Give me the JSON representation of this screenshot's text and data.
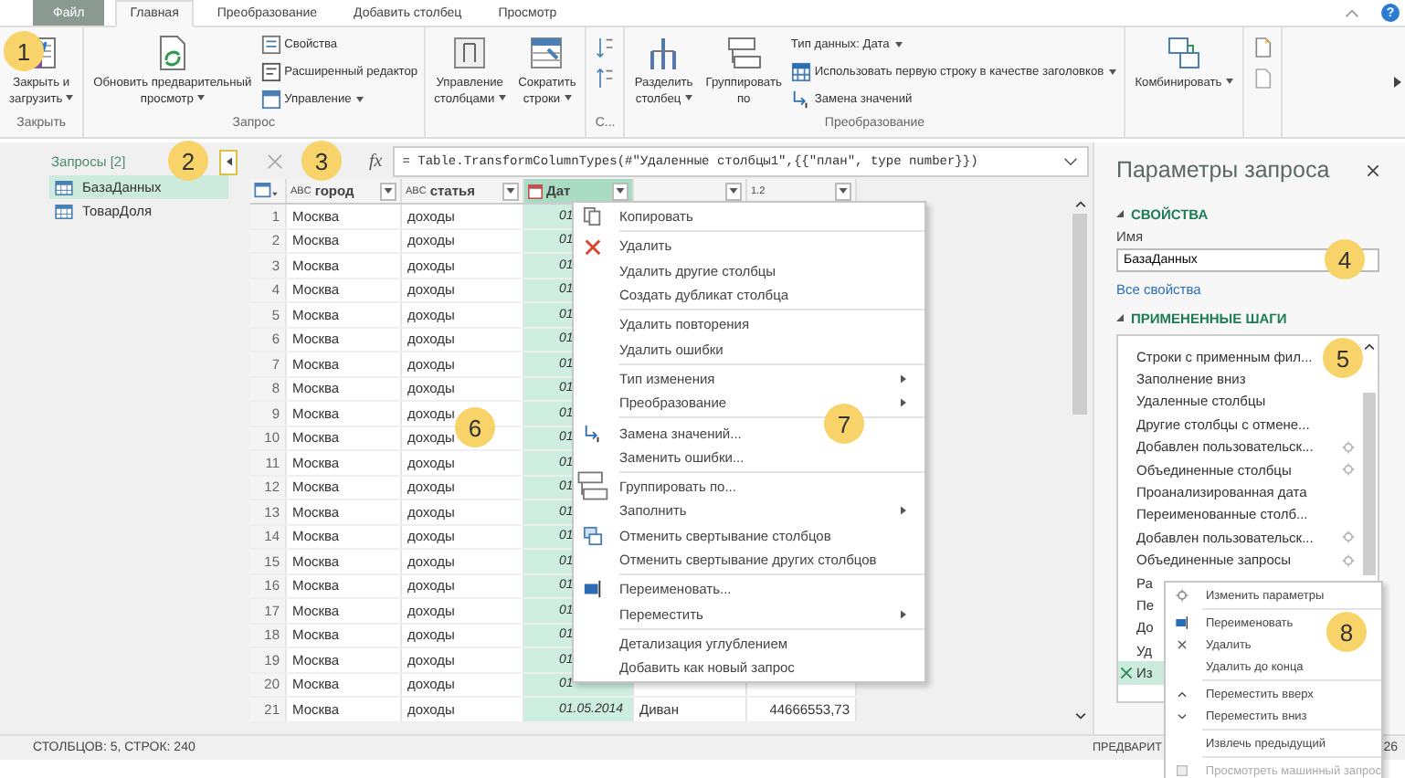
{
  "tabs": [
    {
      "label": "Файл",
      "kind": "file",
      "selected": false
    },
    {
      "label": "Главная",
      "kind": "tab",
      "selected": true
    },
    {
      "label": "Преобразование",
      "kind": "tab",
      "selected": false
    },
    {
      "label": "Добавить столбец",
      "kind": "tab",
      "selected": false
    },
    {
      "label": "Просмотр",
      "kind": "tab",
      "selected": false
    }
  ],
  "help_button": "?",
  "ribbon": {
    "groups": [
      {
        "label": "Закрыть",
        "buttons": [
          {
            "label": "Закрыть и\nзагрузить",
            "kind": "large",
            "dropdown": true
          }
        ]
      },
      {
        "label": "Запрос",
        "buttons": [
          {
            "label": "Обновить предварительный\nпросмотр",
            "kind": "large",
            "dropdown": true
          },
          {
            "label": "Свойства",
            "kind": "small",
            "dropdown": false
          },
          {
            "label": "Расширенный редактор",
            "kind": "small",
            "dropdown": false
          },
          {
            "label": "Управление",
            "kind": "small",
            "dropdown": true
          }
        ]
      },
      {
        "buttons": [
          {
            "label": "Управление\nстолбцами",
            "kind": "large",
            "dropdown": true
          },
          {
            "label": "Сократить\nстроки",
            "kind": "large",
            "dropdown": true
          }
        ]
      },
      {
        "label": "С...",
        "buttons": [
          {
            "kind": "sort"
          }
        ]
      },
      {
        "label": "Преобразование",
        "buttons": [
          {
            "label": "Разделить\nстолбец",
            "kind": "large",
            "dropdown": true
          },
          {
            "label": "Группировать\nпо",
            "kind": "large",
            "dropdown": false
          },
          {
            "label": "Тип данных: Дата",
            "kind": "small",
            "dropdown": true
          },
          {
            "label": "Использовать первую строку в качестве заголовков",
            "kind": "small",
            "dropdown": true
          },
          {
            "label": "Замена значений",
            "kind": "small",
            "dropdown": false
          }
        ]
      },
      {
        "buttons": [
          {
            "label": "Комбинировать",
            "kind": "large",
            "dropdown": true
          }
        ]
      },
      {
        "buttons": [
          {
            "kind": "icons"
          }
        ]
      }
    ]
  },
  "queries": {
    "title": "Запросы [2]",
    "items": [
      {
        "label": "БазаДанных",
        "selected": true
      },
      {
        "label": "ТоварДоля",
        "selected": false
      }
    ]
  },
  "formula_bar": {
    "fx": "fx",
    "formula": "= Table.TransformColumnTypes(#\"Удаленные столбцы1\",{{\"план\", type number}})"
  },
  "table": {
    "columns": [
      {
        "kind": "index",
        "selected": false
      },
      {
        "label": "город",
        "type": "ABC",
        "kind": "text",
        "selected": false
      },
      {
        "label": "статья",
        "type": "ABC",
        "kind": "text",
        "selected": false
      },
      {
        "label": "Дат",
        "kind": "date",
        "selected": true
      },
      {
        "kind": "text",
        "selected": false
      },
      {
        "type": "1.2",
        "kind": "number",
        "selected": false
      }
    ],
    "rows": [
      [
        "1",
        "Москва",
        "доходы",
        "01"
      ],
      [
        "2",
        "Москва",
        "доходы",
        "01"
      ],
      [
        "3",
        "Москва",
        "доходы",
        "01"
      ],
      [
        "4",
        "Москва",
        "доходы",
        "01"
      ],
      [
        "5",
        "Москва",
        "доходы",
        "01"
      ],
      [
        "6",
        "Москва",
        "доходы",
        "01"
      ],
      [
        "7",
        "Москва",
        "доходы",
        "01"
      ],
      [
        "8",
        "Москва",
        "доходы",
        "01"
      ],
      [
        "9",
        "Москва",
        "доходы",
        "01"
      ],
      [
        "10",
        "Москва",
        "доходы",
        "01"
      ],
      [
        "11",
        "Москва",
        "доходы",
        "01"
      ],
      [
        "12",
        "Москва",
        "доходы",
        "01"
      ],
      [
        "13",
        "Москва",
        "доходы",
        "01"
      ],
      [
        "14",
        "Москва",
        "доходы",
        "01"
      ],
      [
        "15",
        "Москва",
        "доходы",
        "01"
      ],
      [
        "16",
        "Москва",
        "доходы",
        "01"
      ],
      [
        "17",
        "Москва",
        "доходы",
        "01"
      ],
      [
        "18",
        "Москва",
        "доходы",
        "01"
      ],
      [
        "19",
        "Москва",
        "доходы",
        "01"
      ],
      [
        "20",
        "Москва",
        "доходы",
        "01"
      ],
      [
        "21",
        "Москва",
        "доходы",
        "01.05.2014",
        "Диван",
        "44666553,73"
      ]
    ]
  },
  "column_menu": [
    [
      {
        "label": "Копировать",
        "has_submenu": false
      }
    ],
    [
      {
        "label": "Удалить",
        "has_submenu": false
      },
      {
        "label": "Удалить другие столбцы",
        "has_submenu": false
      },
      {
        "label": "Создать дубликат столбца",
        "has_submenu": false
      }
    ],
    [
      {
        "label": "Удалить повторения",
        "has_submenu": false
      },
      {
        "label": "Удалить ошибки",
        "has_submenu": false
      }
    ],
    [
      {
        "label": "Тип изменения",
        "has_submenu": true
      },
      {
        "label": "Преобразование",
        "has_submenu": true
      }
    ],
    [
      {
        "label": "Замена значений...",
        "has_submenu": false
      },
      {
        "label": "Заменить ошибки...",
        "has_submenu": false
      }
    ],
    [
      {
        "label": "Группировать по...",
        "has_submenu": false
      },
      {
        "label": "Заполнить",
        "has_submenu": true
      },
      {
        "label": "Отменить свертывание столбцов",
        "has_submenu": false
      },
      {
        "label": "Отменить свертывание других столбцов",
        "has_submenu": false
      }
    ],
    [
      {
        "label": "Переименовать...",
        "has_submenu": false
      },
      {
        "label": "Переместить",
        "has_submenu": true
      }
    ],
    [
      {
        "label": "Детализация углублением",
        "has_submenu": false
      },
      {
        "label": "Добавить как новый запрос",
        "has_submenu": false
      }
    ]
  ],
  "query_settings": {
    "title": "Параметры запроса",
    "properties_heading": "СВОЙСТВА",
    "name_label": "Имя",
    "name_value": "БазаДанных",
    "all_properties_link": "Все свойства",
    "steps_heading": "ПРИМЕНЕННЫЕ ШАГИ",
    "steps": [
      {
        "label": "Строки с применным фил...",
        "has_settings": false,
        "selected": false
      },
      {
        "label": "Заполнение вниз",
        "has_settings": false,
        "selected": false
      },
      {
        "label": "Удаленные столбцы",
        "has_settings": false,
        "selected": false
      },
      {
        "label": "Другие столбцы с отмене...",
        "has_settings": false,
        "selected": false
      },
      {
        "label": "Добавлен пользовательск...",
        "has_settings": true,
        "selected": false
      },
      {
        "label": "Объединенные столбцы",
        "has_settings": true,
        "selected": false
      },
      {
        "label": "Проанализированная дата",
        "has_settings": false,
        "selected": false
      },
      {
        "label": "Переименованные столб...",
        "has_settings": false,
        "selected": false
      },
      {
        "label": "Добавлен пользовательск...",
        "has_settings": true,
        "selected": false
      },
      {
        "label": "Объединенные запросы",
        "has_settings": true,
        "selected": false
      },
      {
        "label": "Ра",
        "has_settings": false,
        "selected": false
      },
      {
        "label": "Пе",
        "has_settings": false,
        "selected": false
      },
      {
        "label": "До",
        "has_settings": false,
        "selected": false
      },
      {
        "label": "Уд",
        "has_settings": false,
        "selected": false
      },
      {
        "label": "Из",
        "has_settings": false,
        "selected": true
      }
    ]
  },
  "step_menu": [
    [
      {
        "label": "Изменить параметры",
        "disabled": false
      }
    ],
    [
      {
        "label": "Переименовать",
        "disabled": false
      },
      {
        "label": "Удалить",
        "disabled": false
      },
      {
        "label": "Удалить до конца",
        "disabled": false
      }
    ],
    [
      {
        "label": "Переместить вверх",
        "disabled": false
      },
      {
        "label": "Переместить вниз",
        "disabled": false
      }
    ],
    [
      {
        "label": "Извлечь предыдущий",
        "disabled": false
      }
    ],
    [
      {
        "label": "Просмотреть машинный запрос",
        "disabled": true
      }
    ]
  ],
  "status_bar": {
    "left": "СТОЛБЦОВ: 5, СТРОК: 240",
    "right": "ПРЕДВАРИТ",
    "right_end": "26"
  },
  "callouts": [
    "1",
    "2",
    "3",
    "4",
    "5",
    "6",
    "7",
    "8"
  ]
}
